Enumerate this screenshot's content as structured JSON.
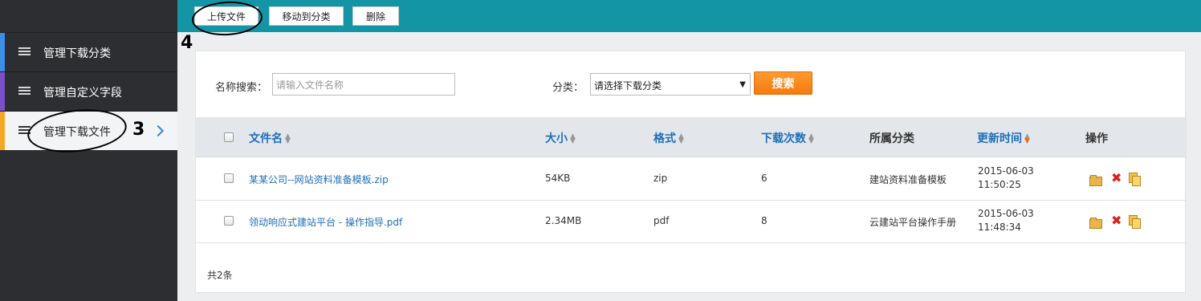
{
  "toolbar": {
    "upload_label": "上传文件",
    "move_label": "移动到分类",
    "delete_label": "删除"
  },
  "sidebar": {
    "items": [
      {
        "label": "管理下载分类",
        "accent": "#3d8ee6",
        "active": false
      },
      {
        "label": "管理自定义字段",
        "accent": "#7b4fc9",
        "active": false
      },
      {
        "label": "管理下载文件",
        "accent": "#f5a623",
        "active": true
      }
    ]
  },
  "annotations": {
    "step3": "3",
    "step4": "4"
  },
  "search": {
    "name_label": "名称搜索：",
    "name_placeholder": "请输入文件名称",
    "category_label": "分类：",
    "category_selected": "请选择下载分类",
    "search_button": "搜索"
  },
  "table": {
    "columns": {
      "filename": "文件名",
      "size": "大小",
      "format": "格式",
      "downloads": "下载次数",
      "category": "所属分类",
      "updated": "更新时间",
      "actions": "操作"
    },
    "rows": [
      {
        "filename": "某某公司--网站资料准备模板.zip",
        "size": "54KB",
        "format": "zip",
        "downloads": "6",
        "category": "建站资料准备模板",
        "date": "2015-06-03",
        "time": "11:50:25"
      },
      {
        "filename": "领动响应式建站平台 - 操作指导.pdf",
        "size": "2.34MB",
        "format": "pdf",
        "downloads": "8",
        "category": "云建站平台操作手册",
        "date": "2015-06-03",
        "time": "11:48:34"
      }
    ],
    "total": "共2条"
  },
  "colors": {
    "topbar": "#1495a6",
    "sidebar": "#2d2e31",
    "link": "#1d6fb8",
    "search_button": "#f57a0f"
  },
  "icons": [
    "menu-icon",
    "chevron-right-icon",
    "sort-icon",
    "edit-folder-icon",
    "delete-icon",
    "copy-icon"
  ]
}
